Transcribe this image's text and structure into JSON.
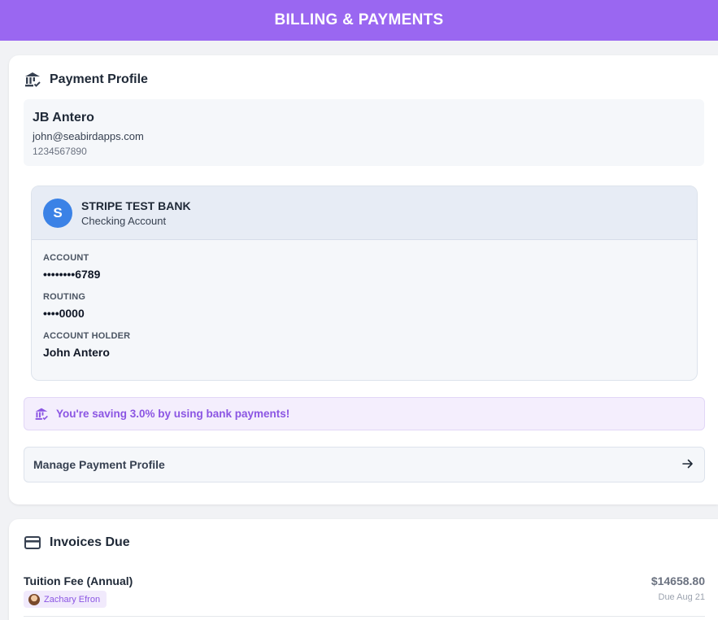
{
  "header": {
    "title": "BILLING & PAYMENTS"
  },
  "payment_profile": {
    "title": "Payment Profile",
    "name": "JB Antero",
    "email": "john@seabirdapps.com",
    "phone": "1234567890"
  },
  "bank": {
    "avatar_letter": "S",
    "name": "STRIPE TEST BANK",
    "type": "Checking Account",
    "fields": [
      {
        "label": "ACCOUNT",
        "value": "••••••••6789"
      },
      {
        "label": "ROUTING",
        "value": "••••0000"
      },
      {
        "label": "ACCOUNT HOLDER",
        "value": "John Antero"
      }
    ]
  },
  "savings": {
    "text": "You're saving 3.0% by using bank payments!"
  },
  "manage": {
    "label": "Manage Payment Profile"
  },
  "invoices": {
    "title": "Invoices Due",
    "items": [
      {
        "title": "Tuition Fee (Annual)",
        "student": "Zachary Efron",
        "amount": "$14658.80",
        "due": "Due Aug 21"
      }
    ]
  },
  "colors": {
    "accent": "#9a67f1",
    "bank_avatar": "#3b82e6",
    "savings_text": "#8b55e3"
  }
}
